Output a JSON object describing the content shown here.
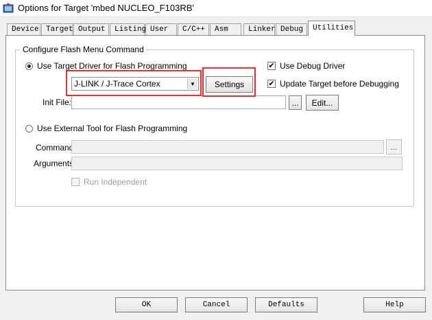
{
  "window": {
    "title": "Options for Target 'mbed NUCLEO_F103RB'"
  },
  "tabs": [
    {
      "label": "Device"
    },
    {
      "label": "Target"
    },
    {
      "label": "Output"
    },
    {
      "label": "Listing"
    },
    {
      "label": "User"
    },
    {
      "label": "C/C++"
    },
    {
      "label": "Asm"
    },
    {
      "label": "Linker"
    },
    {
      "label": "Debug"
    },
    {
      "label": "Utilities"
    }
  ],
  "active_tab": "Utilities",
  "flash_group": {
    "legend": "Configure Flash Menu Command",
    "use_target_driver": {
      "label": "Use Target Driver for Flash Programming",
      "selected": true
    },
    "driver_select": {
      "value": "J-LINK / J-Trace Cortex"
    },
    "settings_button": "Settings",
    "use_debug_driver": {
      "label": "Use Debug Driver",
      "checked": true
    },
    "update_target": {
      "label": "Update Target before Debugging",
      "checked": true
    },
    "init_file": {
      "label": "Init File:",
      "value": "",
      "browse_label": "...",
      "edit_label": "Edit..."
    },
    "use_external_tool": {
      "label": "Use External Tool for Flash Programming",
      "selected": false
    },
    "command": {
      "label": "Command:",
      "value": "",
      "browse_label": "..."
    },
    "arguments": {
      "label": "Arguments:",
      "value": ""
    },
    "run_independent": {
      "label": "Run Independent",
      "checked": false
    }
  },
  "buttons": {
    "ok": "OK",
    "cancel": "Cancel",
    "defaults": "Defaults",
    "help": "Help"
  },
  "colors": {
    "highlight": "#e03030",
    "panel_bg": "#ffffff",
    "dialog_bg": "#f0f0f0"
  }
}
